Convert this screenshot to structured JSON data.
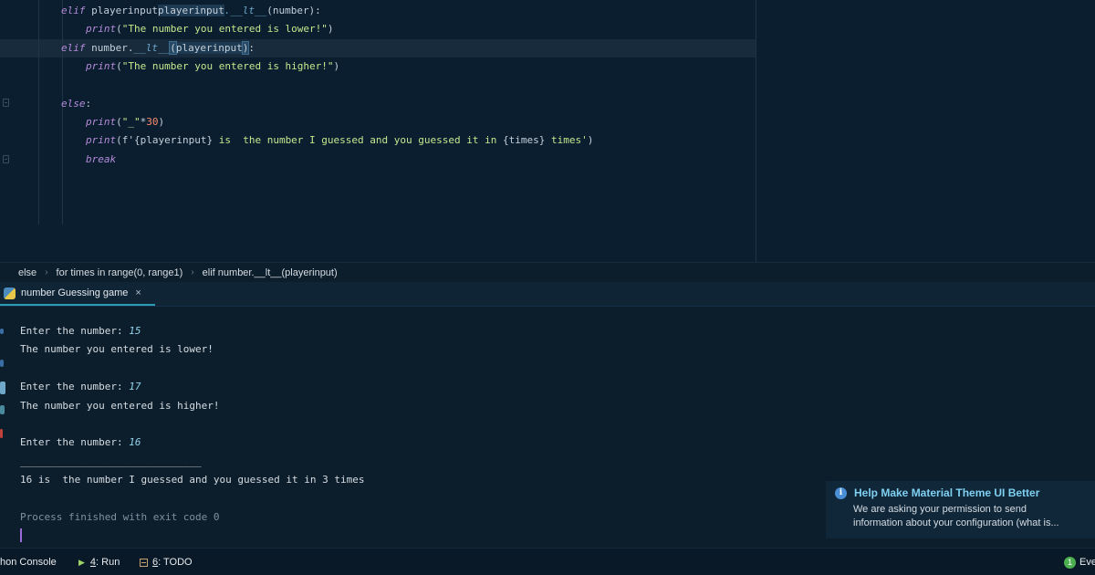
{
  "editor": {
    "lines": [
      {
        "parts": [
          [
            "kw",
            "elif "
          ],
          [
            "id",
            "playerinput"
          ],
          [
            "ref",
            "playerinput"
          ],
          [
            "dunder",
            ".__lt__"
          ],
          [
            "id",
            "(number):"
          ]
        ]
      },
      {
        "parts": [
          [
            "fn",
            "print"
          ],
          [
            "id",
            "("
          ],
          [
            "str",
            "\"The number you entered is lower!\""
          ],
          [
            "id",
            ")"
          ]
        ]
      },
      {
        "parts": [
          [
            "kw",
            "elif "
          ],
          [
            "id",
            "number."
          ],
          [
            "dunder",
            "__lt__"
          ],
          [
            "brace",
            "("
          ],
          [
            "ref",
            "playerinput"
          ],
          [
            "brace",
            ")"
          ],
          [
            "id",
            ":"
          ]
        ]
      },
      {
        "parts": [
          [
            "fn",
            "print"
          ],
          [
            "id",
            "("
          ],
          [
            "str",
            "\"The number you entered is higher!\""
          ],
          [
            "id",
            ")"
          ]
        ]
      },
      {
        "parts": []
      },
      {
        "parts": [
          [
            "kw",
            "else"
          ],
          [
            "id",
            ":"
          ]
        ]
      },
      {
        "parts": [
          [
            "fn",
            "print"
          ],
          [
            "id",
            "("
          ],
          [
            "str",
            "\"_\""
          ],
          [
            "id",
            "*"
          ],
          [
            "num",
            "30"
          ],
          [
            "id",
            ")"
          ]
        ]
      },
      {
        "parts": [
          [
            "fn",
            "print"
          ],
          [
            "id",
            "(f'"
          ],
          [
            "id",
            "{playerinput}"
          ],
          [
            "str",
            " is  the number I guessed and you guessed it in "
          ],
          [
            "id",
            "{times}"
          ],
          [
            "str",
            " times'"
          ],
          [
            "id",
            ")"
          ]
        ]
      },
      {
        "parts": [
          [
            "kw",
            "break"
          ]
        ]
      }
    ],
    "line_texts": [
      "elif playerinput.__lt__(number):",
      "print(\"The number you entered is lower!\")",
      "elif number.__lt__(playerinput):",
      "print(\"The number you entered is higher!\")",
      "",
      "else:",
      "print(\"_\"*30)",
      "print(f'{playerinput} is  the number I guessed and you guessed it in {times} times')",
      "break"
    ]
  },
  "breadcrumb": {
    "items": [
      "else",
      "for times in range(0, range1)",
      "elif number.__lt__(playerinput)"
    ],
    "separator": "›"
  },
  "run_panel": {
    "tab_label": "number Guessing game",
    "close_glyph": "×"
  },
  "console": {
    "lines": [
      {
        "text": "Enter the number: ",
        "input": "15"
      },
      {
        "text": "The number you entered is lower!",
        "input": ""
      },
      {
        "text": "",
        "input": ""
      },
      {
        "text": "Enter the number: ",
        "input": "17"
      },
      {
        "text": "The number you entered is higher!",
        "input": ""
      },
      {
        "text": "",
        "input": ""
      },
      {
        "text": "Enter the number: ",
        "input": "16"
      },
      {
        "text": "______________________________",
        "input": ""
      },
      {
        "text": "16 is  the number I guessed and you guessed it in 3 times",
        "input": ""
      },
      {
        "text": "",
        "input": ""
      },
      {
        "text": "Process finished with exit code 0",
        "input": "",
        "muted": true
      }
    ]
  },
  "notification": {
    "title": "Help Make Material Theme UI Better",
    "body_line1": "We are asking your permission to send",
    "body_line2": "information about your configuration (what is..."
  },
  "toolbar": {
    "python_console": "hon Console",
    "run_mnemonic": "4",
    "run_label": ": Run",
    "todo_mnemonic": "6",
    "todo_label": ": TODO",
    "event_count": "1",
    "event_label": "Eve"
  },
  "colors": {
    "background": "#0a1e30",
    "keyword": "#b58bd9",
    "string": "#c3e88d",
    "number": "#f78c6c",
    "accent": "#2d9bb8"
  }
}
